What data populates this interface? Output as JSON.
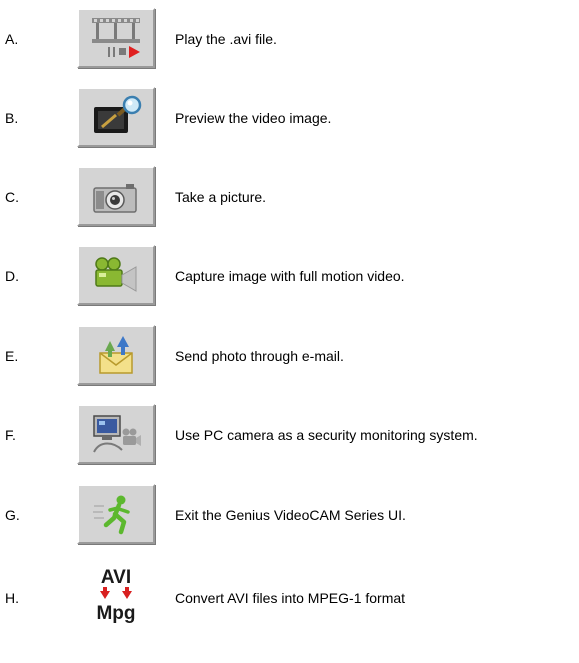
{
  "items": [
    {
      "letter": "A.",
      "description": "Play the .avi file.",
      "icon": "film-play-icon"
    },
    {
      "letter": "B.",
      "description": "Preview the video image.",
      "icon": "preview-magnifier-icon"
    },
    {
      "letter": "C.",
      "description": "Take a picture.",
      "icon": "camera-icon"
    },
    {
      "letter": "D.",
      "description": "Capture image with full motion video.",
      "icon": "video-camera-icon"
    },
    {
      "letter": "E.",
      "description": "Send photo through e-mail.",
      "icon": "email-send-icon"
    },
    {
      "letter": "F.",
      "description": "Use PC camera as a security monitoring system.",
      "icon": "security-monitor-icon"
    },
    {
      "letter": "G.",
      "description": "Exit the Genius VideoCAM Series UI.",
      "icon": "exit-running-man-icon"
    },
    {
      "letter": "H.",
      "description": "Convert AVI files into MPEG-1 format",
      "icon": "avi-to-mpg-icon"
    }
  ],
  "convert_icon": {
    "top_text": "AVI",
    "bottom_text": "Mpg"
  }
}
